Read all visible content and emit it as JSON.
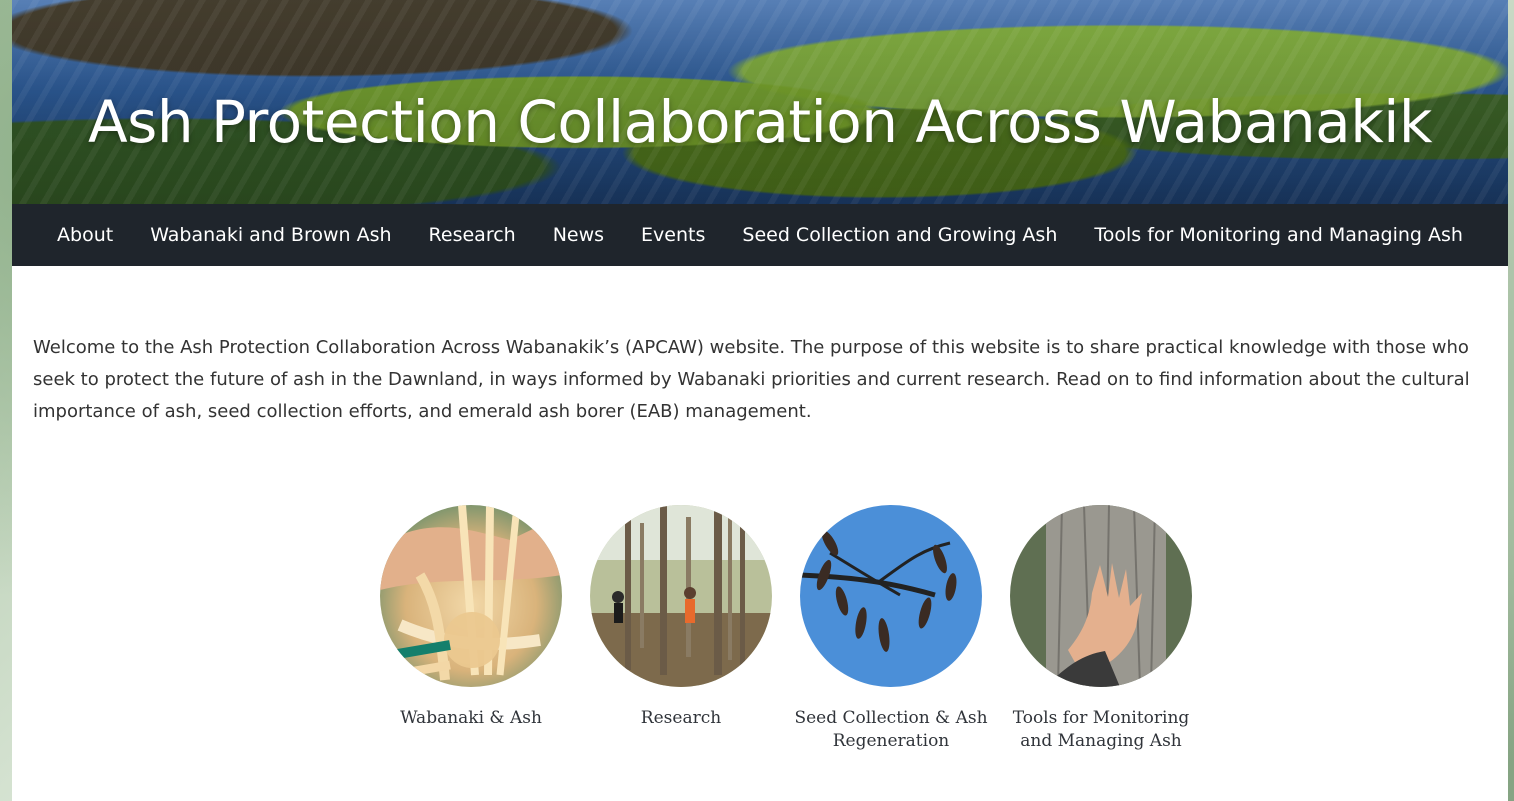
{
  "site": {
    "title": "Ash Protection Collaboration Across Wabanakik"
  },
  "nav": {
    "items": [
      {
        "label": "About"
      },
      {
        "label": "Wabanaki and Brown Ash"
      },
      {
        "label": "Research"
      },
      {
        "label": "News"
      },
      {
        "label": "Events"
      },
      {
        "label": "Seed Collection and Growing Ash"
      },
      {
        "label": "Tools for Monitoring and Managing Ash"
      }
    ]
  },
  "intro": {
    "text": "Welcome to the Ash Protection Collaboration Across Wabanakik’s (APCAW) website. The purpose of this website is to share practical knowledge with those who seek to protect the future of ash in the Dawnland, in ways informed by Wabanaki priorities and current research. Read on to find information about the cultural importance of ash, seed collection efforts, and emerald ash borer (EAB) management."
  },
  "cards": [
    {
      "label": "Wabanaki & Ash",
      "image_name": "basket-weaving-photo"
    },
    {
      "label": "Research",
      "image_name": "forest-research-photo"
    },
    {
      "label": "Seed Collection & Ash Regeneration",
      "image_name": "ash-seeds-branch-photo"
    },
    {
      "label": "Tools for Monitoring and Managing Ash",
      "image_name": "hand-on-tree-bark-photo"
    }
  ],
  "colors": {
    "nav_background": "#1f252c",
    "page_background": "#ffffff",
    "text": "#333333"
  }
}
